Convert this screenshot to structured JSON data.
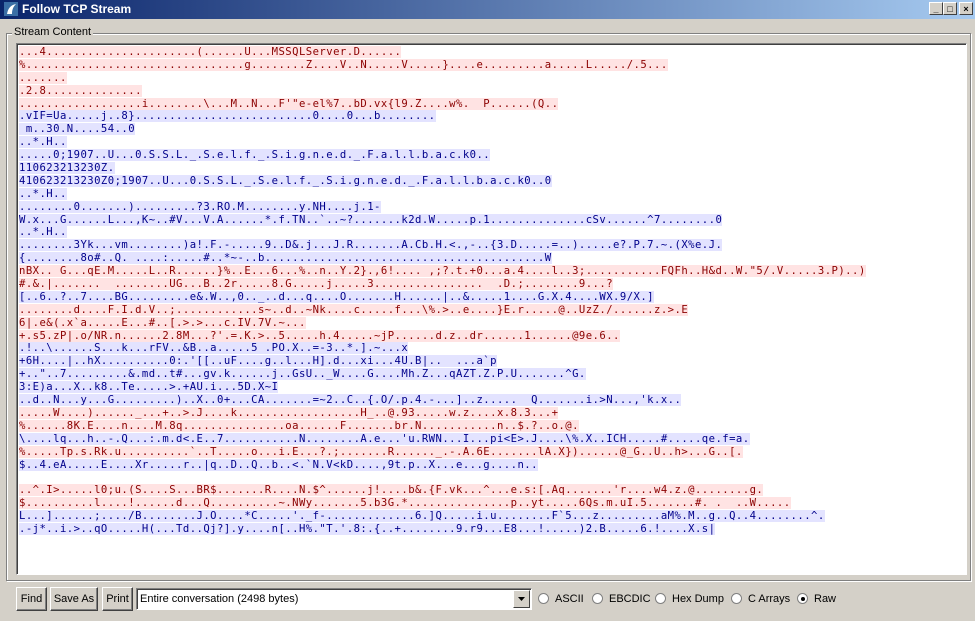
{
  "window": {
    "title": "Follow TCP Stream"
  },
  "group": {
    "label": "Stream Content"
  },
  "stream_lines": [
    {
      "who": "c",
      "text": "...4......................(......U...MSSQLServer.D......"
    },
    {
      "who": "c",
      "text": "%................................g........Z....V..N.....V.....}....e.........a.....L...../.5..."
    },
    {
      "who": "c",
      "text": "......."
    },
    {
      "who": "c",
      "text": ".2.8.............."
    },
    {
      "who": "c",
      "text": "..................i........\\...M..N...F'\"e-el%7..bD.vx{l9.Z....w%.  P......(Q.."
    },
    {
      "who": "s",
      "text": ".vIF=Ua.....j..8}..........................0....0...b........"
    },
    {
      "who": "s",
      "text": " m..30.N....54..0"
    },
    {
      "who": "s",
      "text": "..*.H.."
    },
    {
      "who": "s",
      "text": ".....0;1907..U...0.S.S.L._.S.e.l.f._.S.i.g.n.e.d._.F.a.l.l.b.a.c.k0.."
    },
    {
      "who": "s",
      "text": "110623213230Z."
    },
    {
      "who": "s",
      "text": "410623213230Z0;1907..U...0.S.S.L._.S.e.l.f._.S.i.g.n.e.d._.F.a.l.l.b.a.c.k0..0"
    },
    {
      "who": "s",
      "text": "..*.H.."
    },
    {
      "who": "s",
      "text": "........0.......).........?3.RO.M........y.NH....j.1-"
    },
    {
      "who": "s",
      "text": "W.x...G......L...,K~..#V...V.A......*.f.TN..`..~?.......k2d.W.....p.1..............cSv......^7........0"
    },
    {
      "who": "s",
      "text": "..*.H.."
    },
    {
      "who": "s",
      "text": "........3Yk...vm........)a!.F.-.....9..D&.j...J.R.......A.Cb.H.<.,-..{3.D.....=..).....e?.P.7.~.(X%e.J."
    },
    {
      "who": "s",
      "text": "{........8o#..Q. ....:.....#..*~-..b.........................................W"
    },
    {
      "who": "c",
      "text": "nBX.. G...qE.M.....L..R......}%..E...6...%..n..Y.2}.,6!.... ,;?.t.+0...a.4....l..3;...........FQFh..H&d..W.\"5/.V.....3.P)..)"
    },
    {
      "who": "c",
      "text": "#.&.|.......  ........UG...B..2r.....8.G.....j.....3................  .D.;........9...?"
    },
    {
      "who": "s",
      "text": "[..6..?..7....BG.........e&.W..,0.._..d...q....O.......H......|..&.....1....G.X.4....WX.9/X.]"
    },
    {
      "who": "c",
      "text": "........d....F.I.d.V..;............s~..d..~Nk....c.....f...\\%.>..e....}E.r.....@..UzZ./......z.>.E"
    },
    {
      "who": "c",
      "text": "6|.e&(.x`a.....E...#..[.>.>...c.IV.7V.~..."
    },
    {
      "who": "c",
      "text": "+.s5.zP|.o/NR.n......2.8M...?'.=.K.>..5.....h.4.....~jP......d.z..dr......1......@9e.6.."
    },
    {
      "who": "s",
      "text": ".!..\\......S...k...rFV..&B..a.....5 .PO.X..=-3..*.].~...x"
    },
    {
      "who": "s",
      "text": "+6H....|..hX..........0:.'[[..uF....g..l...H].d...xi...4U.B|..  ...a`p"
    },
    {
      "who": "s",
      "text": "+..\"..7.........&.md..t#...gv.k......j..GsU.._W....G....Mh.Z...qAZT.Z.P.U.......^G."
    },
    {
      "who": "s",
      "text": "3:E)a...X..k8..Te.....>.+AU.i...5D.X~I"
    },
    {
      "who": "s",
      "text": "..d..N...y...G.........)..X..0+...CA.......=~2..C..{.O/.p.4.-...]..z.....  Q.......i.>N...,'k.x.."
    },
    {
      "who": "c",
      "text": ".....W....)......_...+..>.J....k..................H_..@.93.....w.z....x.8.3...+"
    },
    {
      "who": "c",
      "text": "%......8K.E....n....M.8q...............oa......F.......br.N...........n..$.?..o.@."
    },
    {
      "who": "s",
      "text": "\\....lq...h..-.Q...:.m.d<.E..7...........N........A.e...'u.RWN...I...pi<E>.J....\\%.X..ICH.....#.....qe.f=a."
    },
    {
      "who": "c",
      "text": "%.....Tp.s.Rk.u..........`..T.....o...i.E...?.;.......R......_.-.A.6E.......lA.X})......@_G..U..h>...G..[."
    },
    {
      "who": "s",
      "text": "$..4.eA.....E....Xr.....r..|q..D..Q..b..<.`N.V<kD....,9t.p..X...e...g....n.."
    },
    {
      "who": "s",
      "text": ""
    },
    {
      "who": "c",
      "text": "..^.I>.....l0;u.(S....S...BR$.......R....N.$^......j!....b&.{F.vk...^...e.s:[.Aq.......'r....w4.z.@........g."
    },
    {
      "who": "c",
      "text": "$..........l....!......d...Q..........~.NWy.......5.b3G.*...............p..yt.....6Qs.m.uI.5.......#. .  ..W....."
    },
    {
      "who": "s",
      "text": "L...]......;..../B........J.O....*C.....'._f-.............6.]Q.....i.u........F`5...z.........aM%.M..g..Q..4........^."
    },
    {
      "who": "s",
      "text": ".-j*..i.>..qO.....H(...Td..Qj?].y....n[..H%.\"T.'.8:.{..+........9.r9...E8...!.....)2.B.....6.!....X.s|"
    }
  ],
  "buttons": {
    "find": "Find",
    "save_as": "Save As",
    "print": "Print"
  },
  "conversation_select": {
    "value": "Entire conversation (2498 bytes)"
  },
  "radios": [
    {
      "label": "ASCII",
      "checked": false
    },
    {
      "label": "EBCDIC",
      "checked": false
    },
    {
      "label": "Hex Dump",
      "checked": false
    },
    {
      "label": "C Arrays",
      "checked": false
    },
    {
      "label": "Raw",
      "checked": true
    }
  ],
  "colors": {
    "client_bg": "#ffe3e3",
    "client_fg": "#8b0000",
    "server_bg": "#e3e3ff",
    "server_fg": "#00008b",
    "title_start": "#0a246a",
    "title_end": "#a6caf0"
  }
}
